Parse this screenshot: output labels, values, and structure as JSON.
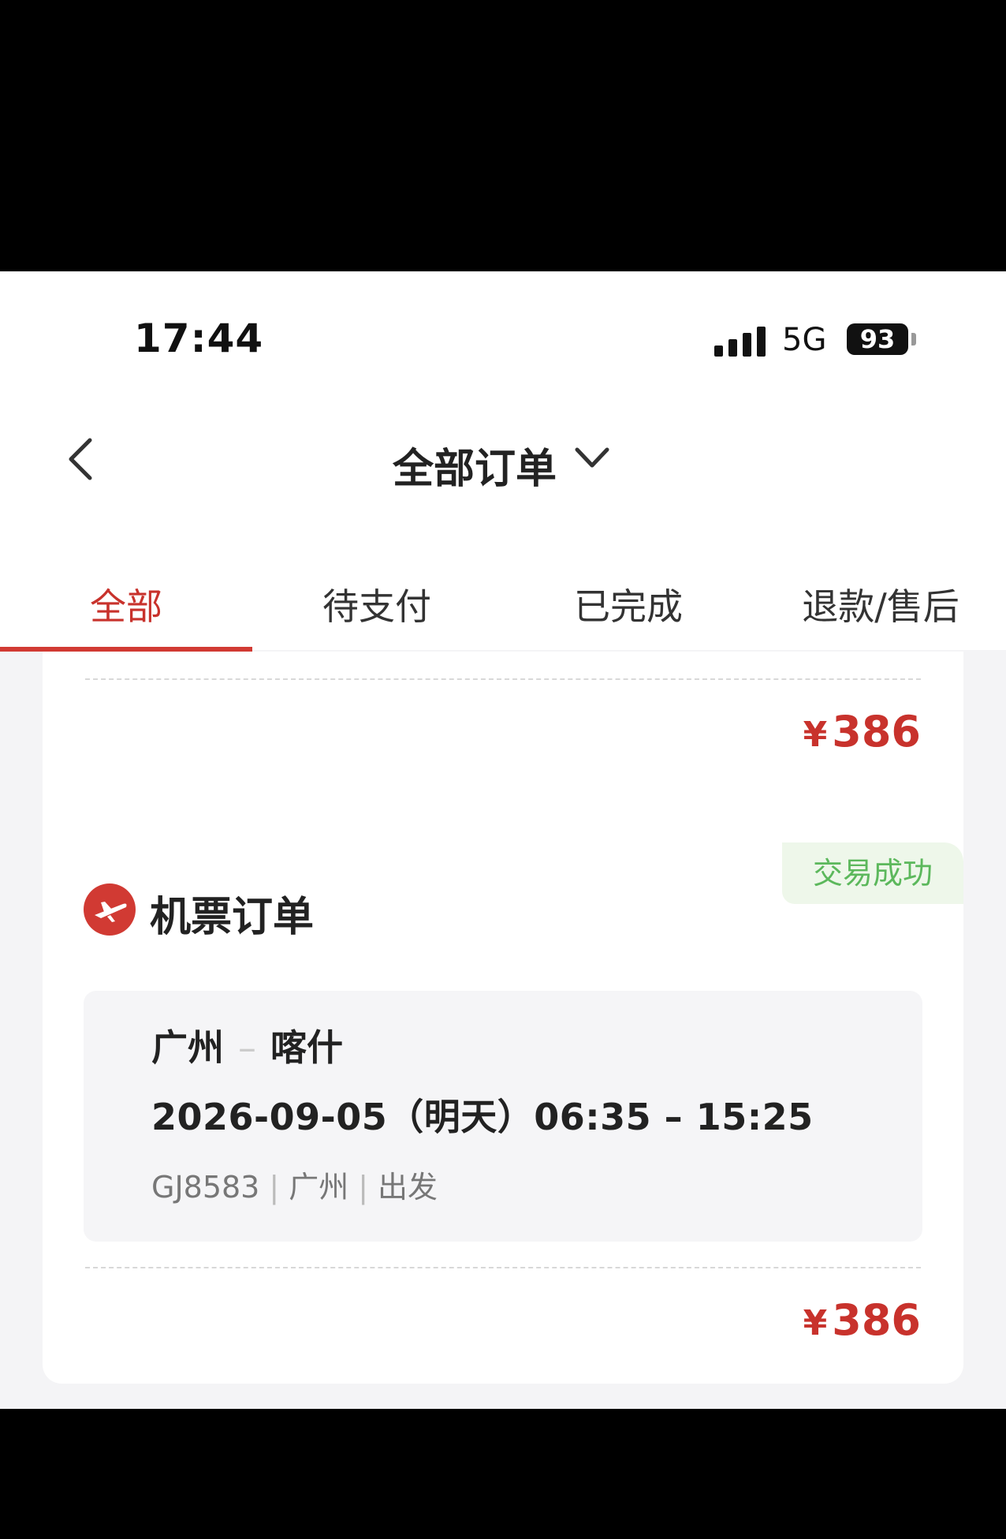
{
  "status_bar": {
    "time": "17:44",
    "network": "5G",
    "battery": "93"
  },
  "nav": {
    "title": "全部订单"
  },
  "tabs": [
    {
      "label": "全部",
      "active": true
    },
    {
      "label": "待支付",
      "active": false
    },
    {
      "label": "已完成",
      "active": false
    },
    {
      "label": "退款/售后",
      "active": false
    }
  ],
  "orders": [
    {
      "price_symbol": "¥",
      "price": "386"
    },
    {
      "type": "机票订单",
      "status": "交易成功",
      "from": "广州",
      "separator": "–",
      "to": "喀什",
      "datetime": "2026-09-05（明天）06:35 – 15:25",
      "flight_no": "GJ8583",
      "city": "广州",
      "action": "出发",
      "price_symbol": "¥",
      "price": "386"
    }
  ],
  "colors": {
    "accent": "#c8322c",
    "success": "#5cb85c",
    "success_bg": "#eef7ea"
  }
}
